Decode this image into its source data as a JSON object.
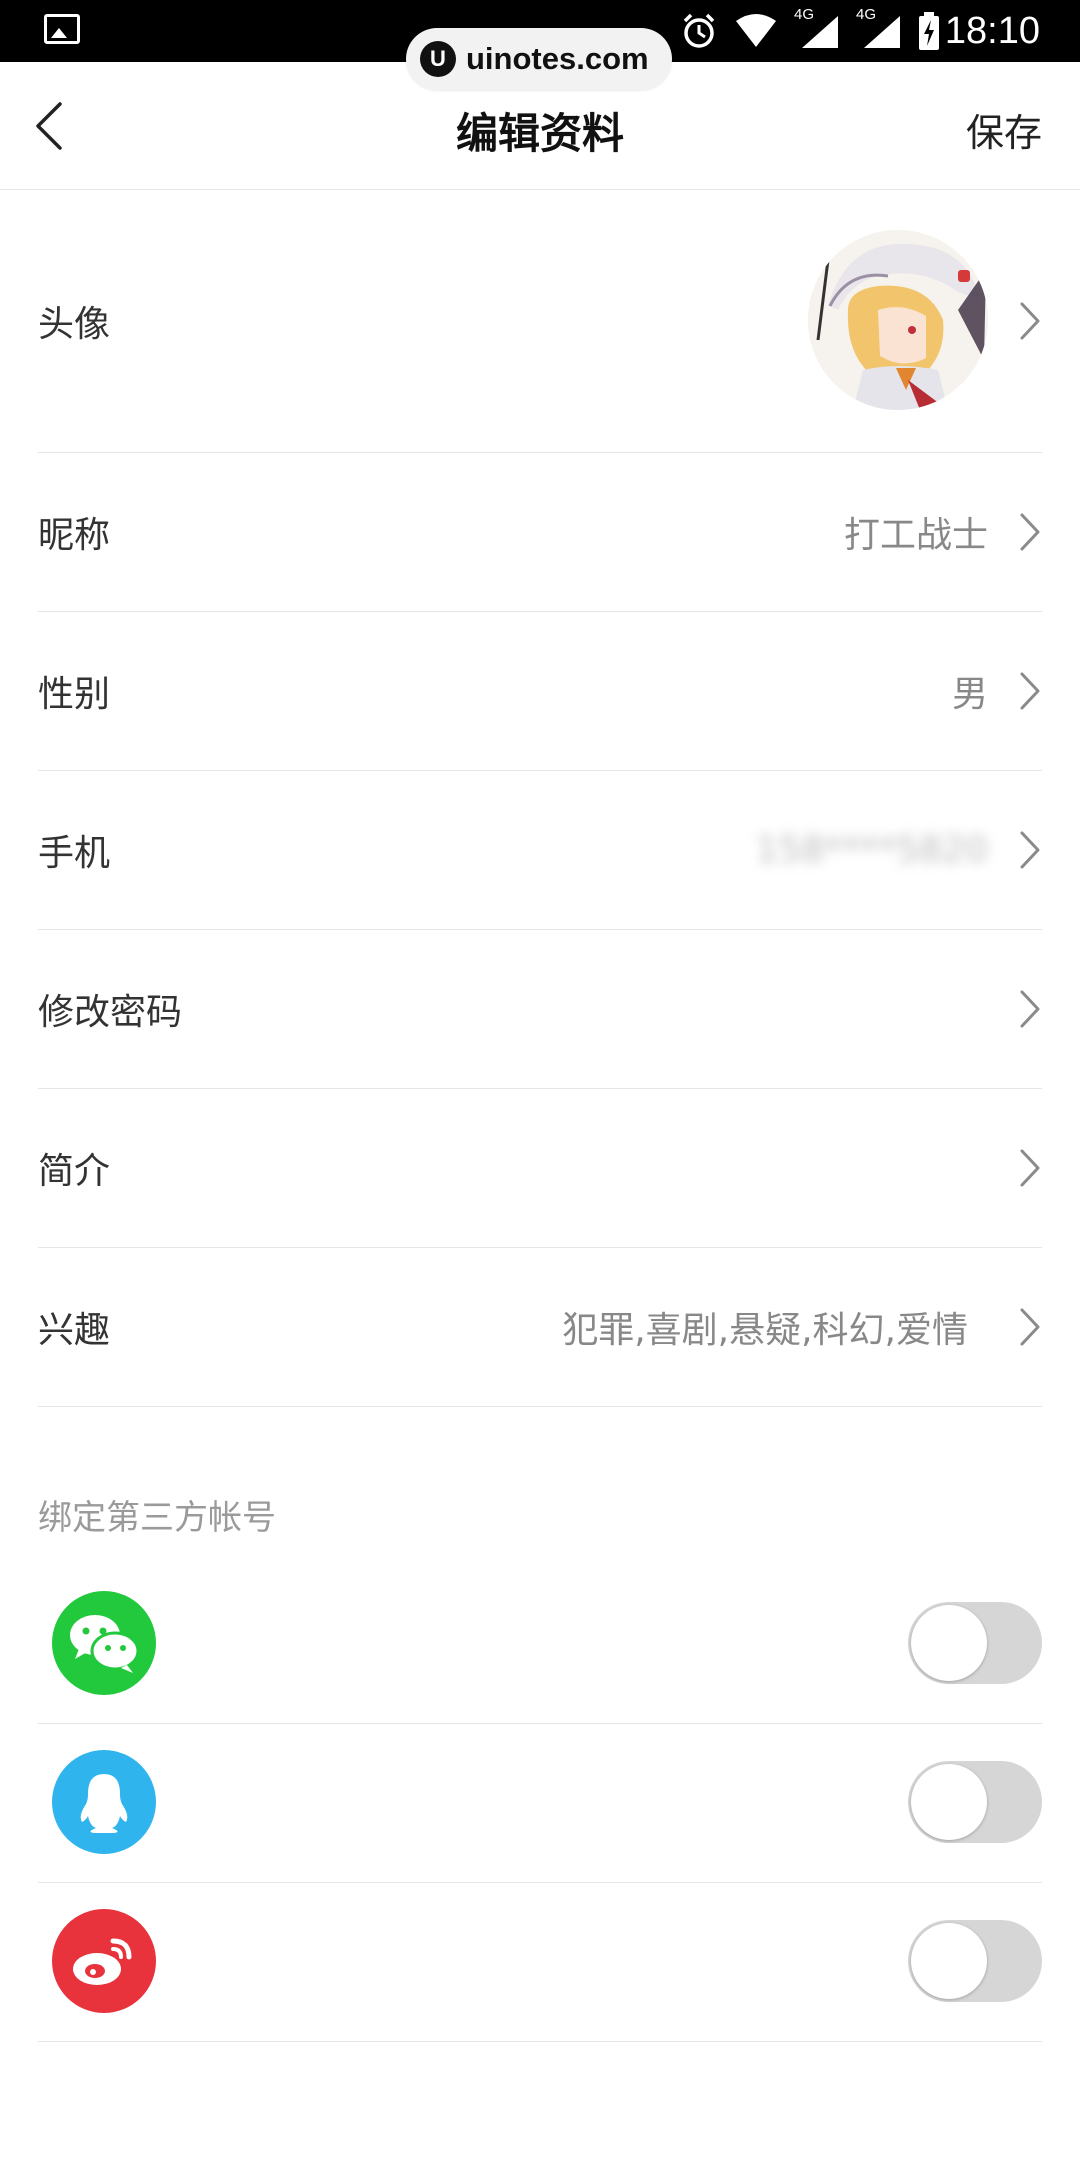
{
  "status_bar": {
    "time": "18:10",
    "network_1": "4G",
    "network_2": "4G"
  },
  "watermark": {
    "logo_letter": "U",
    "text": "uinotes.com"
  },
  "header": {
    "title": "编辑资料",
    "save_label": "保存"
  },
  "profile": {
    "items": [
      {
        "label": "头像",
        "value": ""
      },
      {
        "label": "昵称",
        "value": "打工战士"
      },
      {
        "label": "性别",
        "value": "男"
      },
      {
        "label": "手机",
        "value": "158****5820"
      },
      {
        "label": "修改密码",
        "value": ""
      },
      {
        "label": "简介",
        "value": ""
      },
      {
        "label": "兴趣",
        "value": "犯罪,喜剧,悬疑,科幻,爱情"
      }
    ]
  },
  "third_party": {
    "section_title": "绑定第三方帐号",
    "accounts": [
      {
        "icon": "wechat-icon",
        "color": "#22c93d",
        "bound": false
      },
      {
        "icon": "qq-icon",
        "color": "#2fb4ee",
        "bound": false
      },
      {
        "icon": "weibo-icon",
        "color": "#e8323c",
        "bound": false
      }
    ]
  },
  "colors": {
    "divider": "#e6e6e6",
    "toggle_off": "#d6d6d6",
    "secondary_text": "#888888"
  }
}
